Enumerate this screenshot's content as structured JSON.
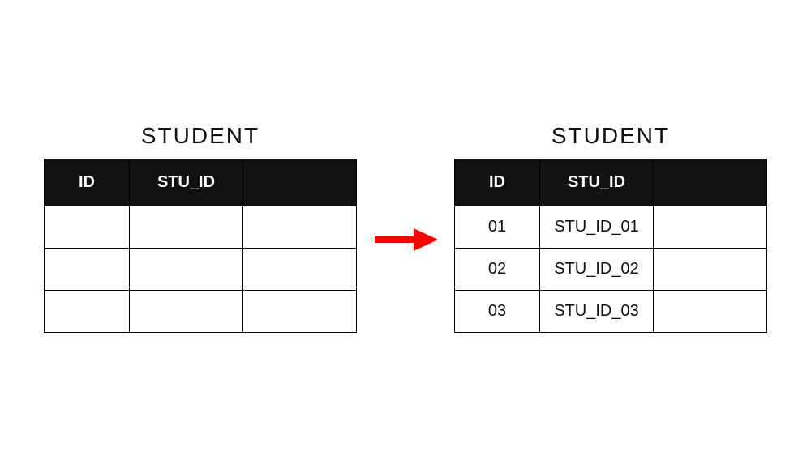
{
  "left_table": {
    "title": "STUDENT",
    "headers": [
      "ID",
      "STU_ID",
      ""
    ],
    "rows": [
      [
        "",
        "",
        ""
      ],
      [
        "",
        "",
        ""
      ],
      [
        "",
        "",
        ""
      ]
    ]
  },
  "right_table": {
    "title": "STUDENT",
    "headers": [
      "ID",
      "STU_ID",
      ""
    ],
    "rows": [
      [
        "01",
        "STU_ID_01",
        ""
      ],
      [
        "02",
        "STU_ID_02",
        ""
      ],
      [
        "03",
        "STU_ID_03",
        ""
      ]
    ]
  },
  "arrow_color": "#ff0000"
}
